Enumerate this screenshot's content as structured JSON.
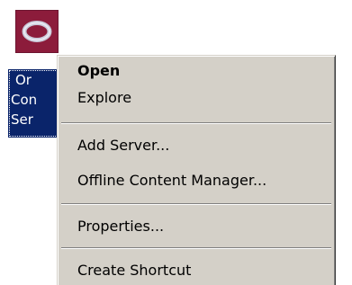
{
  "desktop_icon": {
    "icon": "oracle-icon",
    "label_lines": [
      "Or",
      "Con",
      "Ser"
    ],
    "icon_color": "#8c1c3b",
    "selection_color": "#0a246a"
  },
  "context_menu": {
    "items": [
      {
        "label": "Open",
        "default": true
      },
      {
        "label": "Explore"
      },
      {
        "label": "Add Server..."
      },
      {
        "label": "Offline Content Manager..."
      },
      {
        "label": "Properties..."
      },
      {
        "label": "Create Shortcut"
      }
    ],
    "background": "#d4d0c8"
  }
}
